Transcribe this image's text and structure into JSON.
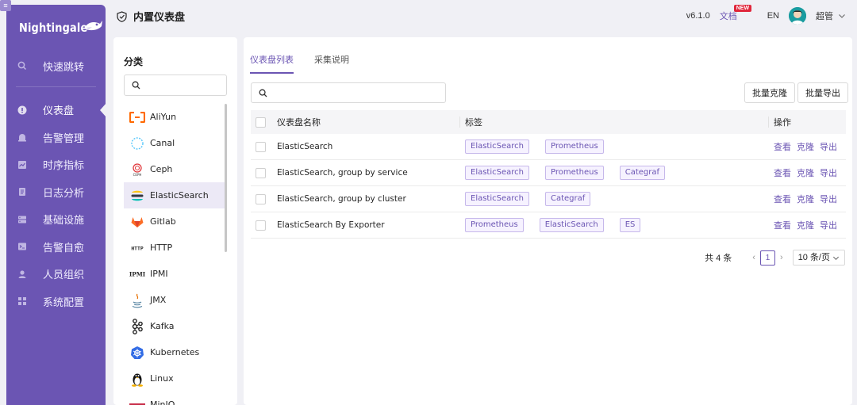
{
  "app": {
    "logo_text": "Nightingale",
    "menu_badge": "≡"
  },
  "sidebar": {
    "items": [
      {
        "label": "快速跳转",
        "icon": "search-icon"
      },
      {
        "label": "仪表盘",
        "icon": "dashboard-icon",
        "active": true
      },
      {
        "label": "告警管理",
        "icon": "alarm-icon"
      },
      {
        "label": "时序指标",
        "icon": "chart-icon"
      },
      {
        "label": "日志分析",
        "icon": "log-icon"
      },
      {
        "label": "基础设施",
        "icon": "server-icon"
      },
      {
        "label": "告警自愈",
        "icon": "terminal-icon"
      },
      {
        "label": "人员组织",
        "icon": "user-icon"
      },
      {
        "label": "系统配置",
        "icon": "settings-icon"
      }
    ]
  },
  "header": {
    "title": "内置仪表盘",
    "version": "v6.1.0",
    "docs": "文档",
    "new_badge": "NEW",
    "lang": "EN",
    "username": "超管"
  },
  "categories": {
    "title": "分类",
    "search_placeholder": "",
    "items": [
      {
        "label": "AliYun",
        "icon": "aliyun-icon"
      },
      {
        "label": "Canal",
        "icon": "canal-icon"
      },
      {
        "label": "Ceph",
        "icon": "ceph-icon"
      },
      {
        "label": "ElasticSearch",
        "icon": "elasticsearch-icon",
        "active": true
      },
      {
        "label": "Gitlab",
        "icon": "gitlab-icon"
      },
      {
        "label": "HTTP",
        "icon": "http-icon"
      },
      {
        "label": "IPMI",
        "icon": "ipmi-icon"
      },
      {
        "label": "JMX",
        "icon": "java-icon"
      },
      {
        "label": "Kafka",
        "icon": "kafka-icon"
      },
      {
        "label": "Kubernetes",
        "icon": "kubernetes-icon"
      },
      {
        "label": "Linux",
        "icon": "linux-icon"
      },
      {
        "label": "MinIO",
        "icon": "minio-icon"
      }
    ],
    "icon_texts": {
      "http": "HTTP",
      "ipmi": "IPMI",
      "ceph": "CEPH"
    }
  },
  "main": {
    "tabs": [
      {
        "label": "仪表盘列表",
        "active": true
      },
      {
        "label": "采集说明",
        "active": false
      }
    ],
    "search_placeholder": "",
    "buttons": {
      "batch_clone": "批量克隆",
      "batch_export": "批量导出"
    },
    "table": {
      "headers": {
        "name": "仪表盘名称",
        "tags": "标签",
        "ops": "操作"
      },
      "rows": [
        {
          "name": "ElasticSearch",
          "tags": [
            "ElasticSearch",
            "Prometheus"
          ],
          "ops": [
            "查看",
            "克隆",
            "导出"
          ]
        },
        {
          "name": "ElasticSearch, group by service",
          "tags": [
            "ElasticSearch",
            "Prometheus",
            "Categraf"
          ],
          "ops": [
            "查看",
            "克隆",
            "导出"
          ]
        },
        {
          "name": "ElasticSearch, group by cluster",
          "tags": [
            "ElasticSearch",
            "Categraf"
          ],
          "ops": [
            "查看",
            "克隆",
            "导出"
          ]
        },
        {
          "name": "ElasticSearch By Exporter",
          "tags": [
            "Prometheus",
            "ElasticSearch",
            "ES"
          ],
          "ops": [
            "查看",
            "克隆",
            "导出"
          ]
        }
      ]
    },
    "pagination": {
      "total": "共 4 条",
      "current_page": "1",
      "page_size": "10 条/页"
    }
  },
  "colors": {
    "brand": "#6b55b3",
    "tag_bg": "#f6f2ff",
    "tag_border": "#c6b8eb",
    "new_badge": "#e0263b"
  }
}
